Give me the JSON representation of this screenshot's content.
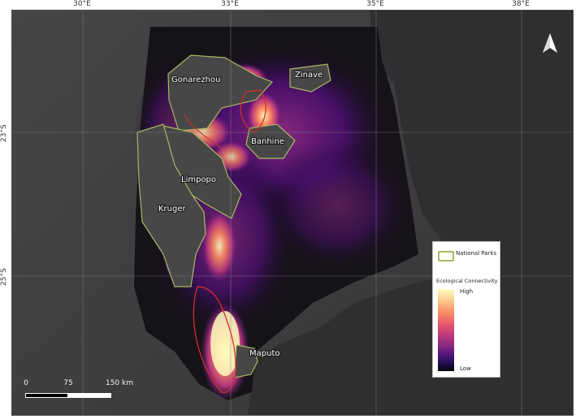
{
  "map": {
    "graticule": {
      "longitude_labels": [
        "30°E",
        "33°E",
        "35°E",
        "38°E"
      ],
      "latitude_labels": [
        "23°S",
        "25°S"
      ]
    },
    "parks": {
      "gonarezhou": "Gonarezhou",
      "zinave": "Zinave",
      "banhine": "Banhine",
      "limpopo": "Limpopo",
      "kruger": "Kruger",
      "maputo": "Maputo"
    },
    "north_arrow_icon": "north-arrow-icon"
  },
  "legend": {
    "national_parks_label": "National Parks",
    "connectivity_title": "Ecological Connectivity",
    "high_label": "High",
    "low_label": "Low"
  },
  "scale_bar": {
    "label_0": "0",
    "label_75": "75",
    "label_150": "150 km"
  },
  "colors": {
    "park_outline": "#a8b963",
    "corridor_outline": "#d22d2d",
    "background": "#2e2e30"
  }
}
